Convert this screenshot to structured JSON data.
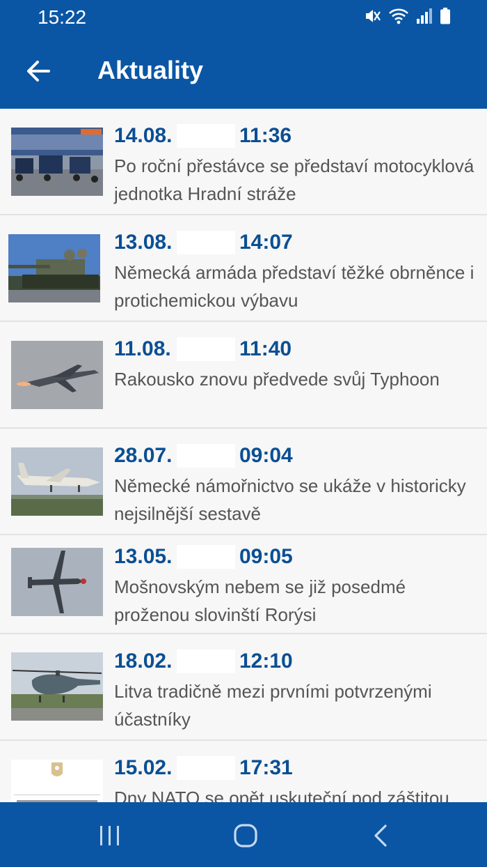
{
  "status_bar": {
    "time": "15:22",
    "icons": [
      "mute-icon",
      "wifi-icon",
      "signal-icon",
      "battery-icon"
    ]
  },
  "app_bar": {
    "title": "Aktuality",
    "back_icon": "arrow-left-icon"
  },
  "news": [
    {
      "date": "14.08.",
      "time": "11:36",
      "title": "Po roční přestávce se představí motocyklová jednotka Hradní stráže",
      "thumb": "motorcycle-unit-photo"
    },
    {
      "date": "13.08.",
      "time": "14:07",
      "title": "Německá armáda představí těžké obrněnce i protichemickou výbavu",
      "thumb": "tank-photo"
    },
    {
      "date": "11.08.",
      "time": "11:40",
      "title": "Rakousko znovu předvede svůj Typhoon",
      "thumb": "typhoon-jet-photo"
    },
    {
      "date": "28.07.",
      "time": "09:04",
      "title": "Německé námořnictvo se ukáže v historicky nejsilnější sestavě",
      "thumb": "naval-aircraft-photo"
    },
    {
      "date": "13.05.",
      "time": "09:05",
      "title": "Mošnovským nebem se již posedmé proženou slovinští Rorýsi",
      "thumb": "propeller-aircraft-photo"
    },
    {
      "date": "18.02.",
      "time": "12:10",
      "title": "Litva tradičně mezi prvními potvrzenými účastníky",
      "thumb": "helicopter-photo"
    },
    {
      "date": "15.02.",
      "time": "17:31",
      "title": "Dny NATO se opět uskuteční pod záštitou",
      "thumb": "president-emblem-image"
    }
  ],
  "colors": {
    "primary": "#0a56a5",
    "date_text": "#0b4f93",
    "headline_text": "#555555",
    "list_bg": "#f7f7f7"
  },
  "nav_bar": {
    "icons": [
      "recent-apps-icon",
      "home-icon",
      "back-chevron-icon"
    ]
  }
}
